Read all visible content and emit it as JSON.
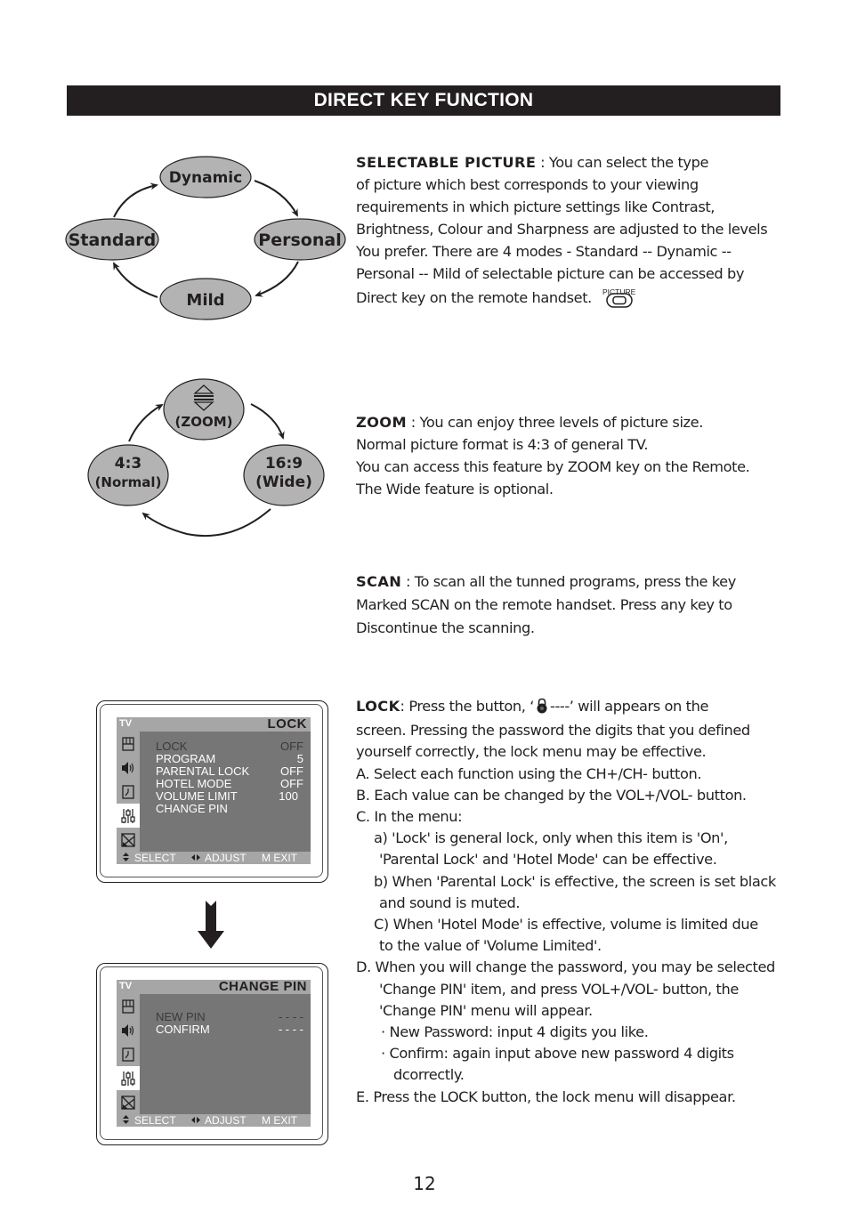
{
  "banner": {
    "title": "DIRECT KEY FUNCTION"
  },
  "picture_diagram": {
    "modes": [
      "Dynamic",
      "Personal",
      "Mild",
      "Standard"
    ]
  },
  "selectable_picture": {
    "heading": "SELECTABLE  PICTURE",
    "lines": [
      ": You can select the type",
      "of picture which best corresponds to your viewing",
      "requirements in which picture settings like Contrast,",
      "Brightness, Colour and Sharpness are adjusted to the levels",
      "You prefer. There are 4 modes - Standard -- Dynamic --",
      "Personal -- Mild of selectable picture can be accessed by",
      "Direct key on the remote handset."
    ],
    "key_label": "PICTURE",
    "key_icon": "picture-key-icon"
  },
  "zoom_diagram": {
    "top_label": "(ZOOM)",
    "left_line1": "4:3",
    "left_line2": "(Normal)",
    "right_line1": "16:9",
    "right_line2": "(Wide)"
  },
  "zoom": {
    "heading": "ZOOM",
    "lines": [
      ": You can enjoy three levels of picture size.",
      "Normal picture format is 4:3 of general TV.",
      "You can access this feature by ZOOM key on the Remote.",
      "The Wide feature is optional."
    ]
  },
  "scan": {
    "heading": "SCAN",
    "lines": [
      ": To scan all the tunned programs, press the key",
      "Marked SCAN on the remote handset. Press any key to",
      "Discontinue the scanning."
    ]
  },
  "lock": {
    "heading": "LOCK",
    "intro_pre": ": Press the button,  ‘",
    "intro_code": "----’",
    "intro_post": "  will appears on the",
    "lines": [
      "screen. Pressing the password the digits that you defined",
      "yourself correctly, the lock menu may be effective.",
      "A. Select each function using the CH+/CH- button.",
      "B. Each value can be changed by the VOL+/VOL- button.",
      "C. In the menu:"
    ],
    "sub_a1": "a) 'Lock' is general lock, only when this item is 'On',",
    "sub_a2": "'Parental Lock' and 'Hotel Mode' can be effective.",
    "sub_b1": "b)  When 'Parental Lock' is effective, the screen is set black",
    "sub_b2": "and sound is muted.",
    "sub_c1": "C)  When 'Hotel Mode' is effective, volume is limited due",
    "sub_c2": "to the value of  'Volume Limited'.",
    "d1": "D.  When you will change the password, you may be selected",
    "d2": "'Change PIN' item, and press  VOL+/VOL- button, the",
    "d3": "'Change PIN' menu will appear.",
    "bullet1": "· New Password: input 4 digits you like.",
    "bullet2a": "· Confirm: again input above new password 4 digits",
    "bullet2b": "dcorrectly.",
    "e": "E. Press the LOCK button, the lock menu will disappear."
  },
  "osd_lock": {
    "tv": "TV",
    "title": "LOCK",
    "rows": [
      {
        "label": "LOCK",
        "value": "OFF",
        "highlighted": false
      },
      {
        "label": "PROGRAM",
        "value": "5",
        "highlighted": true
      },
      {
        "label": "PARENTAL LOCK",
        "value": "OFF",
        "highlighted": true
      },
      {
        "label": "HOTEL MODE",
        "value": "OFF",
        "highlighted": true
      },
      {
        "label": "VOLUME LIMIT",
        "value": "100",
        "highlighted": true
      },
      {
        "label": "CHANGE PIN",
        "value": "",
        "highlighted": true
      }
    ],
    "footer": {
      "select": "SELECT",
      "adjust": "ADJUST",
      "exit": "M EXIT"
    }
  },
  "osd_change_pin": {
    "tv": "TV",
    "title": "CHANGE PIN",
    "rows": [
      {
        "label": "NEW PIN",
        "value": "- - - -",
        "highlighted": false
      },
      {
        "label": "CONFIRM",
        "value": "- - - -",
        "highlighted": true
      }
    ],
    "footer": {
      "select": "SELECT",
      "adjust": "ADJUST",
      "exit": "M EXIT"
    }
  },
  "side_icons": [
    "picture-icon",
    "sound-icon",
    "clock-icon",
    "function-icon",
    "channel-icon"
  ],
  "colors": {
    "ink": "#231f20",
    "oval_fill": "#b3b3b3",
    "osd_body": "#767676",
    "osd_bar": "#a6a6a6"
  },
  "page_number": "12"
}
